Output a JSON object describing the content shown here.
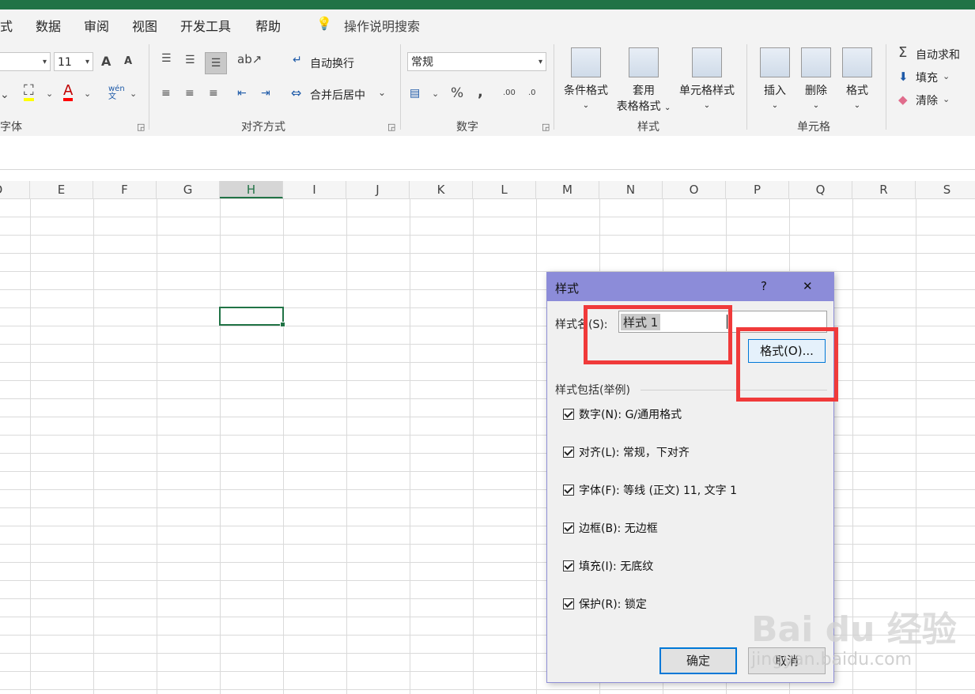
{
  "menu": {
    "items": [
      "式",
      "数据",
      "审阅",
      "视图",
      "开发工具",
      "帮助"
    ],
    "tell_me": "操作说明搜索"
  },
  "ribbon": {
    "font_size": "11",
    "font_group_label": "字体",
    "wrap_text": "自动换行",
    "merge_center": "合并后居中",
    "align_group_label": "对齐方式",
    "number_format": "常规",
    "number_group_label": "数字",
    "cond_format": "条件格式",
    "table_format_1": "套用",
    "table_format_2": "表格格式",
    "cell_styles": "单元格样式",
    "styles_group_label": "样式",
    "insert": "插入",
    "delete": "删除",
    "format": "格式",
    "cells_group_label": "单元格",
    "autosum": "自动求和",
    "fill": "填充",
    "clear": "清除",
    "grow_font": "A",
    "shrink_font": "A",
    "font_color_glyph": "A",
    "phonetic": "wén 文",
    "percent": "%",
    "comma": ",",
    "inc_decimal": ".00",
    "dec_decimal": ".0",
    "sigma": "Σ"
  },
  "columns": [
    "D",
    "E",
    "F",
    "G",
    "H",
    "I",
    "J",
    "K",
    "L",
    "M",
    "N",
    "O",
    "P",
    "Q",
    "R",
    "S"
  ],
  "active_column": "H",
  "dialog": {
    "title": "样式",
    "help": "?",
    "close": "✕",
    "style_name_label": "样式名(S):",
    "style_name_value": "样式 1",
    "format_button": "格式(O)...",
    "includes_label": "样式包括(举例)",
    "checks": [
      "数字(N): G/通用格式",
      "对齐(L): 常规，下对齐",
      "字体(F): 等线 (正文) 11, 文字 1",
      "边框(B): 无边框",
      "填充(I): 无底纹",
      "保护(R): 锁定"
    ],
    "ok": "确定",
    "cancel": "取消"
  },
  "watermark": {
    "brand": "Bai du 经验",
    "url": "jingyan.baidu.com"
  },
  "colors": {
    "excel_green": "#217346",
    "dialog_title": "#8c8cd9",
    "highlight_red": "#f03a3a"
  }
}
